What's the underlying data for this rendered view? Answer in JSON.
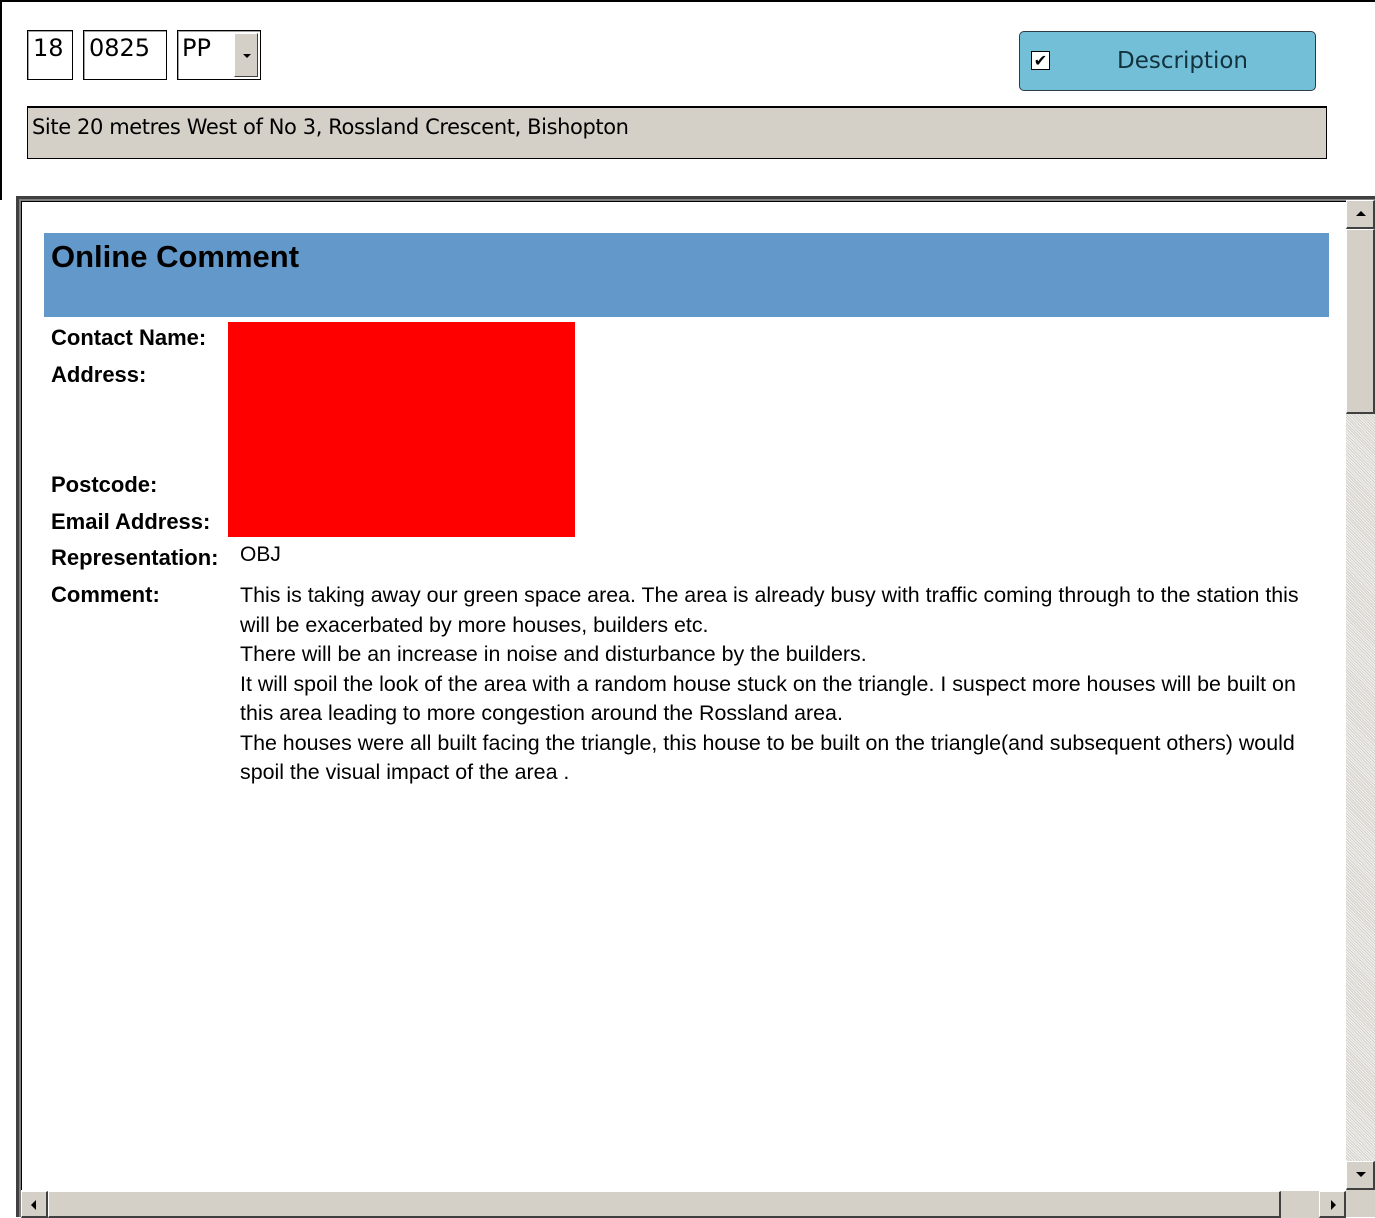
{
  "header": {
    "year": "18",
    "number": "0825",
    "type_value": "PP",
    "description_button": {
      "label": "Description",
      "checked": true,
      "check_glyph": "✔"
    },
    "site_address": "Site 20 metres West of No 3, Rossland Crescent, Bishopton"
  },
  "document": {
    "title": "Online Comment",
    "labels": {
      "contact_name": "Contact Name:",
      "address": "Address:",
      "postcode": "Postcode:",
      "email": "Email Address:",
      "representation": "Representation:",
      "comment": "Comment:"
    },
    "representation_value": "OBJ",
    "comment_paragraphs": [
      "This is taking away our green space area. The area is already busy with traffic coming through to the station this will be exacerbated by more houses, builders etc.",
      "There will be an increase in noise and disturbance by the builders.",
      "It will spoil the look of the area with a random house stuck on the triangle. I suspect more houses will be built on this area leading to more congestion around the Rossland area.",
      "The houses were all built facing the triangle, this house to be built on the triangle(and subsequent others) would spoil the visual impact of the area ."
    ]
  },
  "colors": {
    "banner": "#6398ca",
    "description_button": "#74bfd8",
    "redaction": "#ff0000",
    "window_gray": "#d4d0c8"
  }
}
